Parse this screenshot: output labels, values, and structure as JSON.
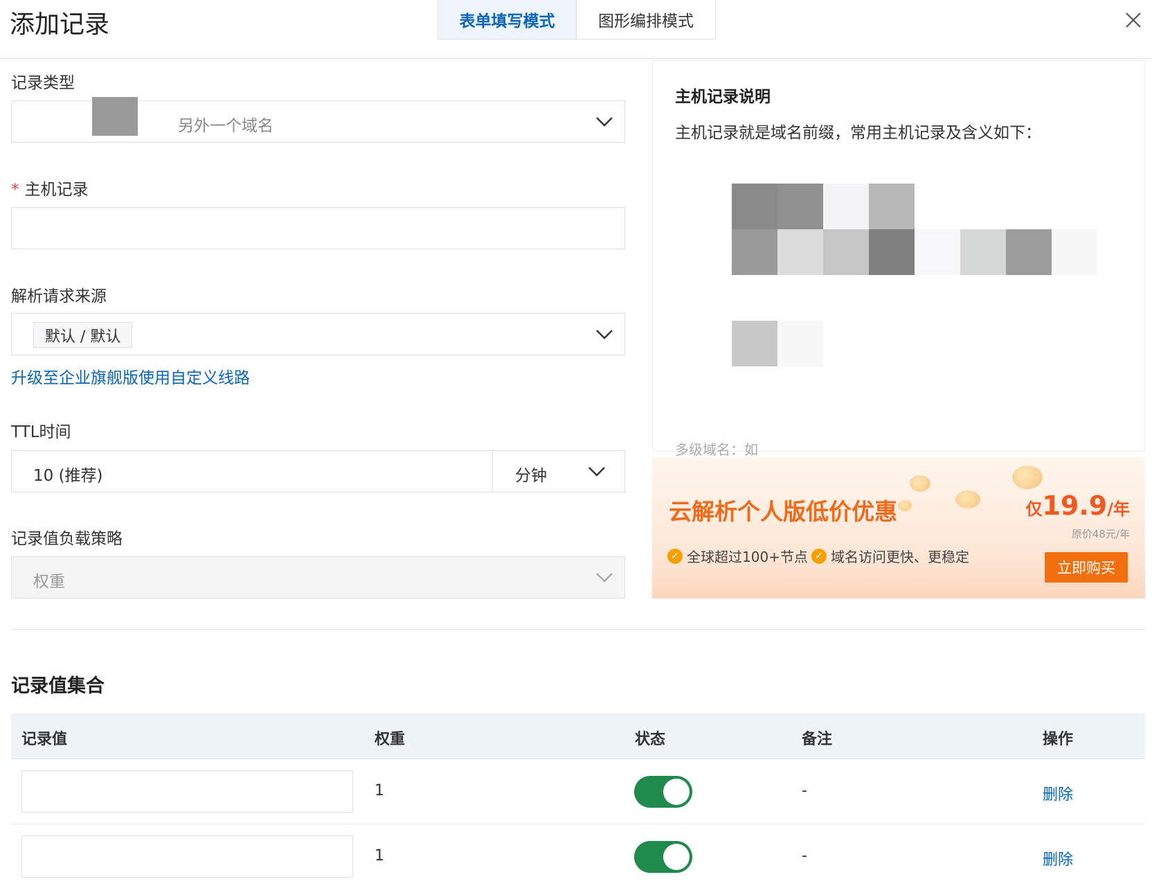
{
  "dialog": {
    "title": "添加记录",
    "tabs": [
      {
        "label": "表单填写模式",
        "active": true
      },
      {
        "label": "图形编排模式",
        "active": false
      }
    ]
  },
  "form": {
    "record_type": {
      "label": "记录类型",
      "value": "另外一个域名"
    },
    "host_record": {
      "label": "主机记录",
      "required_mark": "*",
      "value": ""
    },
    "resolve_source": {
      "label": "解析请求来源",
      "value": "默认 / 默认"
    },
    "upgrade_link": "升级至企业旗舰版使用自定义线路",
    "ttl": {
      "label": "TTL时间",
      "value": "10 (推荐)",
      "unit": "分钟"
    },
    "load_strategy": {
      "label": "记录值负载策略",
      "value": "权重",
      "disabled": true
    }
  },
  "help": {
    "title": "主机记录说明",
    "desc": "主机记录就是域名前缀，常用主机记录及含义如下：",
    "faded_text": "多级域名：如"
  },
  "promo": {
    "title": "云解析个人版低价优惠",
    "price_prefix": "仅",
    "price": "19.9",
    "price_unit": "/年",
    "original_price": "原价48元/年",
    "features": [
      "全球超过100+节点",
      "域名访问更快、更稳定"
    ],
    "buy_label": "立即购买"
  },
  "records": {
    "title": "记录值集合",
    "columns": [
      "记录值",
      "权重",
      "状态",
      "备注",
      "操作"
    ],
    "rows": [
      {
        "value": "",
        "weight": "1",
        "enabled": true,
        "remark": "-",
        "action": "删除"
      },
      {
        "value": "",
        "weight": "1",
        "enabled": true,
        "remark": "-",
        "action": "删除"
      }
    ]
  },
  "colors": {
    "accent": "#0a64b8",
    "toggle_on": "#1f8a4c",
    "promo_orange": "#f26f0f",
    "required": "#e5463a"
  }
}
